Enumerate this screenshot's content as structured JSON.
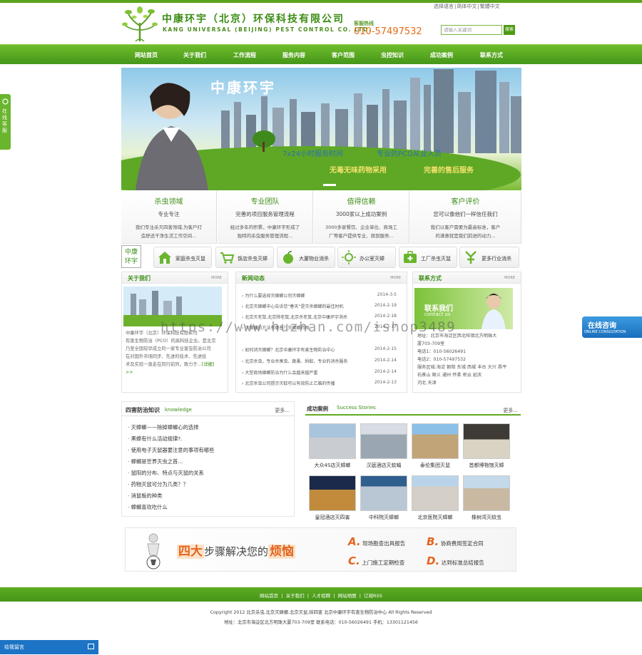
{
  "header": {
    "company_cn": "中康环宇（北京）环保科技有限公司",
    "company_en": "KANG UNIVERSAL (BEIJING) PEST CONTROL CO. LTD.",
    "hotline_label": "客服热线",
    "hotline_number": "010-57497532",
    "toplinks": [
      "选择语言",
      "简体中文",
      "繁體中文"
    ],
    "search_placeholder": "请输入关键词",
    "search_button": "搜索"
  },
  "nav": {
    "items": [
      "网站首页",
      "关于我们",
      "工作流程",
      "服务内容",
      "客户范围",
      "虫控知识",
      "成功案例",
      "联系方式"
    ]
  },
  "banner": {
    "title": "中康环宇",
    "line1_left": "7x24小时服务时间",
    "line1_right": "专业的PCO从业人员",
    "line2_left": "无毒无味药物采用",
    "line2_right": "完善的售后服务"
  },
  "features": [
    {
      "title": "杀虫领域",
      "subtitle": "专业专注",
      "desc1": "我们专注杀灭四害领域,为客户打",
      "desc2": "造舒适干净生活工作空间..."
    },
    {
      "title": "专业团队",
      "subtitle": "完善的项目服务管理流程",
      "desc1": "经过多年的积累，中康环宇形成了",
      "desc2": "独特的杀虫服务管理流程..."
    },
    {
      "title": "值得信赖",
      "subtitle": "3000家以上成功案例",
      "desc1": "3000多家餐饮、企业单位、商场工",
      "desc2": "厂等客户提供专业、周到服务..."
    },
    {
      "title": "客户评价",
      "subtitle": "您可以像他们一样信任我们",
      "desc1": "我们以客户需要为最高标准，客户",
      "desc2": "的满意就是我们前进的动力..."
    }
  ],
  "services": {
    "logo_line1": "中康",
    "logo_line2": "环宇",
    "items": [
      "家庭杀虫灭鼠",
      "饭店杀虫灭蟑",
      "大厦物业消杀",
      "办公室灭蟑",
      "工厂杀虫灭鼠",
      "更多行业消杀"
    ]
  },
  "about": {
    "title": "关于我们",
    "more": "MORE",
    "text1": "中康环宇（北京）环保科技有限公司",
    "text2": "有害生物防治（PCO）的高科技企业。是北京",
    "text3": "乃至全国较早成立的一家专业害虫防治公司",
    "text4": "在对国外市场同步、先进的技术、先进技",
    "text5": "术及实验一直走在同行前列，致力于...",
    "link": "[详细]",
    "link2": ">>"
  },
  "news": {
    "title": "新闻动态",
    "more": "MORE",
    "items": [
      {
        "title": "为什么要选择灭蟑螂公司灭蟑螂",
        "date": "2014-3-5"
      },
      {
        "title": "北京灭蟑螂中心告诉您“春天”是灭杀蟑螂的最佳时机",
        "date": "2014-2-19"
      },
      {
        "title": "北京灭老鼠,北京除老鼠,北京杀老鼠,北京中康环宇消杀",
        "date": "2014-2-18"
      },
      {
        "title": "灭蟑螂的方法有哪些？灭蟑螂药物",
        "date": "2014-2-17"
      },
      {
        "title": "如何消灭蟑螂？北京中康环宇有害生物防治中心",
        "date": "2014-2-15"
      },
      {
        "title": "北京杀虫，专业杀臭虫、跳蚤、蚂蚁，专业的消杀服务",
        "date": "2014-2-14"
      },
      {
        "title": "大型商场蟑螂防治为什么会越来越严重",
        "date": "2014-2-14"
      },
      {
        "title": "北京杀虫公司提示灭蚊可以有效防止乙脑的传播",
        "date": "2014-2-13"
      }
    ]
  },
  "contact": {
    "title": "联系方式",
    "more": "MORE",
    "banner_cn": "联系我们",
    "banner_en": "contact us",
    "lines": [
      "地址：北京市海淀区西北旺镇北方明珠大",
      "厦703-709室",
      "电话1：010-56026491",
      "电话2：010-57497532",
      "服务区域:海淀 朝阳 东城 西城 丰台 大兴 昌平",
      "石景山 顺义 通州 怀柔 密云 延庆",
      "河北 天津"
    ]
  },
  "knowledge": {
    "title_cn": "四害防治知识",
    "title_en": "knowledge",
    "more": "更多...",
    "items": [
      "灭蟑螂——除掉蟑螂心的选择",
      "黑蟑有什么活动规律?.",
      "使用电子灭鼠器要注意的事项有哪些",
      "蟑螂是世界灭虫之首...",
      "鼠阳的分布、特点与灭鼠的关系",
      "药物灭鼠可分为几类？？",
      "消鼠板的种类",
      "蟑螂喜欢吃什么"
    ]
  },
  "cases": {
    "title_cn": "成功案例",
    "title_en": "Success Stories",
    "more": "更多...",
    "items": [
      "大众4S店灭蟑螂",
      "汉庭酒店灭蚊蝇",
      "泰伦集团灭鼠",
      "首都博物馆灭蟑",
      "皇冠酒店灭四害",
      "中科院灭蟑螂",
      "北京医院灭蟑螂",
      "橡树湾灭蚊虫"
    ]
  },
  "steps": {
    "headline_a": "四大",
    "headline_b": "步骤解决您的",
    "headline_c": "烦恼",
    "items": [
      {
        "letter": "A.",
        "text": "现场勘查出具报告"
      },
      {
        "letter": "B.",
        "text": "协商费用签定合同"
      },
      {
        "letter": "C.",
        "text": "上门施工定期检查"
      },
      {
        "letter": "D.",
        "text": "达到标准总结报告"
      }
    ]
  },
  "footer": {
    "links": [
      "网站首页",
      "关于我们",
      "人才招聘",
      "网站地图",
      "订阅RSS"
    ],
    "copyright": "Copyright 2012 北京杀虫,北京灭蟑螂,北京灭鼠,除四害 北京中康环宇有害生物防治中心 All Rights Reserved",
    "address": "地址：北京市海淀区北方明珠大厦703-709室 联系电话：010-56026491 手机：13301121456"
  },
  "floating": {
    "side_tab": "在线客服",
    "online_cn": "在线咨询",
    "online_en": "ONLINE CONSULTATION",
    "message_bar": "给我留言",
    "watermark": "https://www.huzhan.com/ishop3489"
  },
  "colors": {
    "brand_green": "#4c9a14",
    "hotline_orange": "#e56a14",
    "blue": "#1d73c5"
  }
}
